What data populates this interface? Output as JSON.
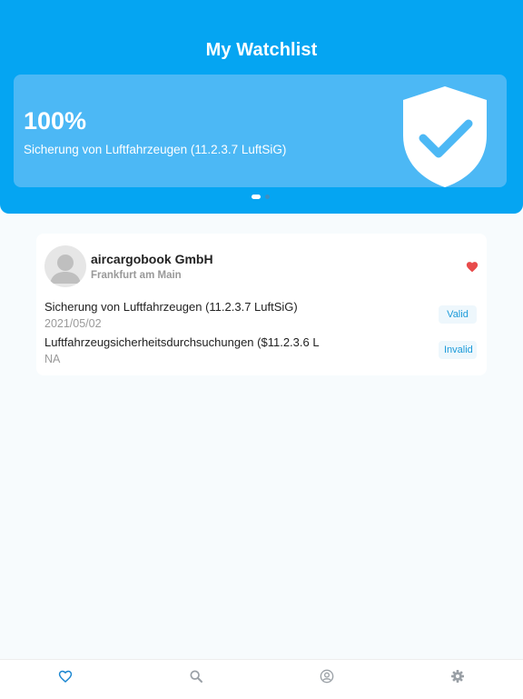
{
  "header": {
    "title": "My Watchlist"
  },
  "banner": {
    "percentage": "100%",
    "subtitle": "Sicherung von Luftfahrzeugen (11.2.3.7 LuftSiG)",
    "icon": "shield-check-icon",
    "slide_count": 2,
    "active_slide": 1
  },
  "watchlist": [
    {
      "company": "aircargobook GmbH",
      "city": "Frankfurt am Main",
      "favorite": true,
      "certifications": [
        {
          "name": "Sicherung von Luftfahrzeugen (11.2.3.7 LuftSiG)",
          "date": "2021/05/02",
          "status": "Valid"
        },
        {
          "name": "Luftfahrzeugsicherheitsdurchsuchungen ($11.2.3.6 L",
          "date": "NA",
          "status": "Invalid"
        }
      ]
    }
  ],
  "tabbar": {
    "tabs": [
      {
        "name": "watchlist",
        "icon": "heart-outline-icon",
        "active": true
      },
      {
        "name": "search",
        "icon": "search-icon",
        "active": false
      },
      {
        "name": "profile",
        "icon": "user-circle-icon",
        "active": false
      },
      {
        "name": "settings",
        "icon": "gear-icon",
        "active": false
      }
    ]
  },
  "colors": {
    "primary": "#05a5f2",
    "banner": "#4cb8f5",
    "favorite": "#e84b4b",
    "active_tab": "#1a86d0",
    "inactive_tab": "#9aa0a6"
  }
}
